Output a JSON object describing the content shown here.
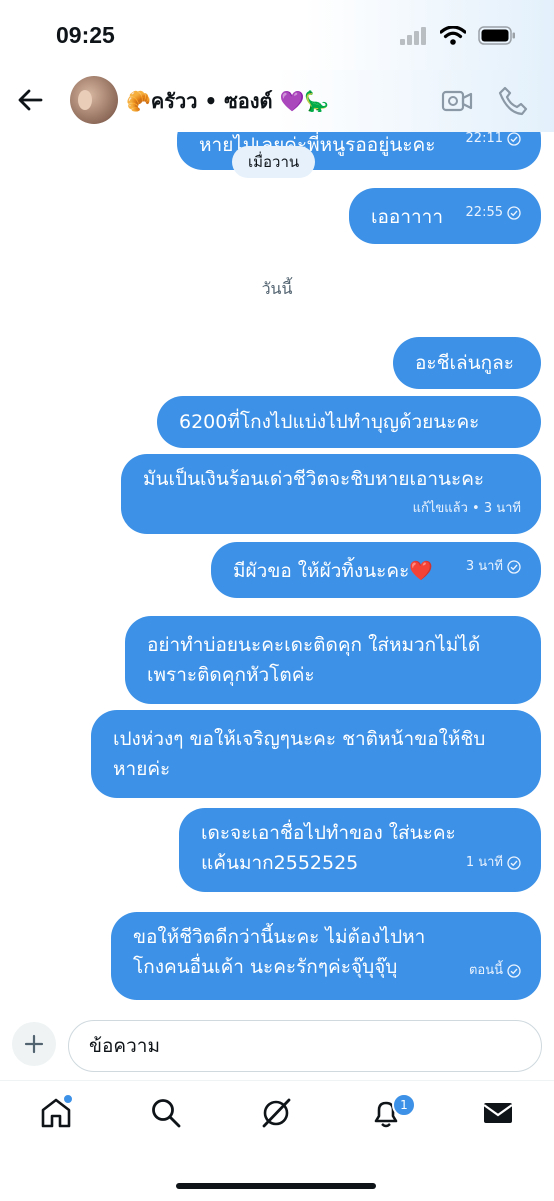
{
  "status": {
    "time": "09:25"
  },
  "header": {
    "title": "🥐ครัวว • ซองต์ 💜🦕"
  },
  "messages": [
    {
      "text": "หายไปเลยค่ะพี่หนูรออยู่นะคะ",
      "time": "22:11"
    },
    {
      "text": "เออาาาา",
      "time": "22:55"
    },
    {
      "text": "อะชีเล่นกูละ"
    },
    {
      "text": "6200ที่โกงไปแบ่งไปทำบุญด้วยนะคะ"
    },
    {
      "text": "มันเป็นเงินร้อนเด่วชีวิตจะชิบหายเอานะคะ",
      "time": "แก้ไขแล้ว • 3 นาที"
    },
    {
      "text": "มีผัวขอ ให้ผัวทิ้งนะคะ❤️",
      "time": "3 นาที"
    },
    {
      "text": "อย่าทำบ่อยนะคะเดะติดคุก ใส่หมวกไม่ได้เพราะติดคุกหัวโตค่ะ"
    },
    {
      "text": "เปงห่วงๆ  ขอให้เจริญๆนะคะ ชาติหน้าขอให้ชิบหายค่ะ"
    },
    {
      "text": "เดะจะเอาชื่อไปทำของ ใส่นะคะ แค้นมาก2552525",
      "time": "1 นาที"
    },
    {
      "text": "ขอให้ชีวิตดีกว่านี้นะคะ ไม่ต้องไปหา โกงคนอื่นเค้า นะคะรักๆค่ะจุ๊บุจุ๊บุ",
      "time": "ตอนนี้"
    }
  ],
  "day_labels": {
    "yesterday": "เมื่อวาน",
    "today": "วันนี้"
  },
  "composer": {
    "placeholder": "ข้อความ"
  },
  "tabbar": {
    "notifications_badge": "1"
  },
  "colors": {
    "bubble": "#3d91e6",
    "accent": "#3d91e6"
  }
}
